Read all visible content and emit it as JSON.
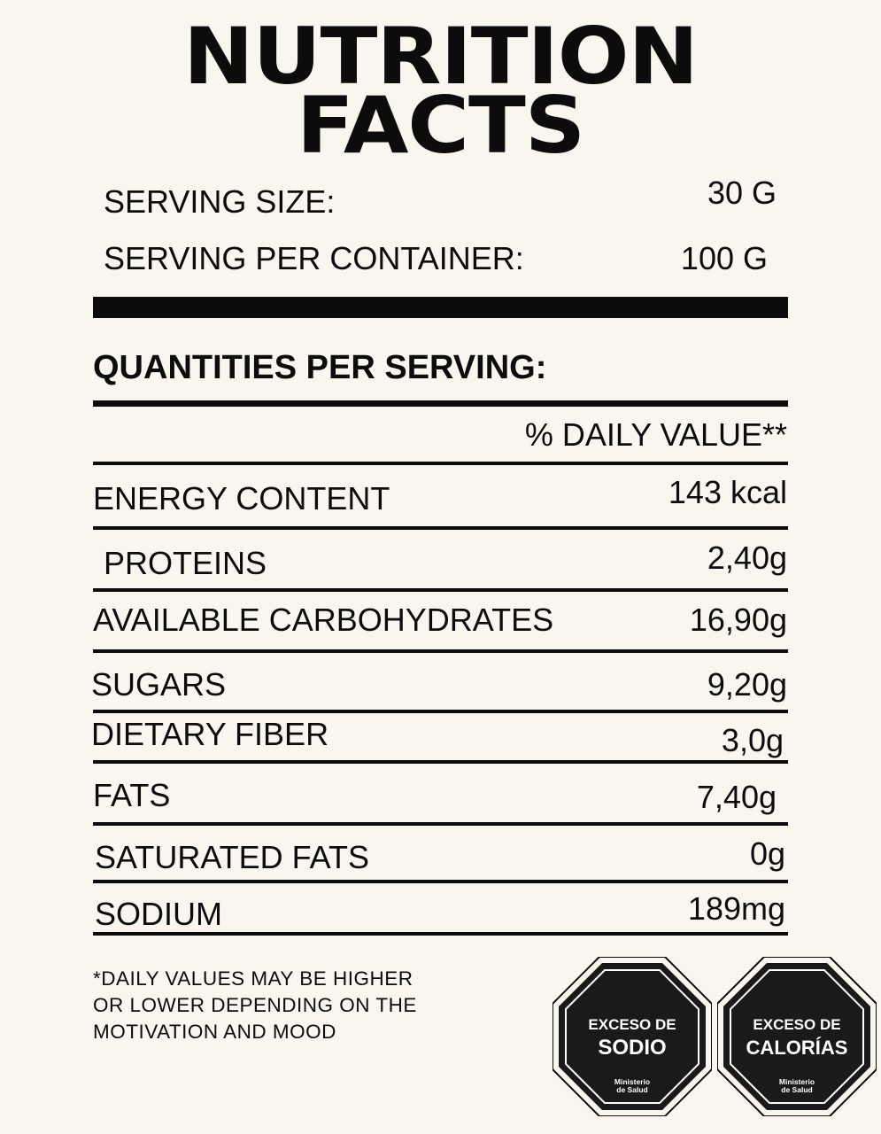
{
  "title": {
    "line1": "NUTRITION",
    "line2": "FACTS"
  },
  "serving": {
    "size_label": "SERVING SIZE:",
    "size_value": "30 G",
    "per_container_label": "SERVING PER CONTAINER:",
    "per_container_value": "100 G"
  },
  "section_heading": "QUANTITIES PER SERVING:",
  "daily_value_header": "% DAILY VALUE**",
  "nutrients": [
    {
      "label": "ENERGY CONTENT",
      "value": "143  kcal"
    },
    {
      "label": "PROTEINS",
      "value": "2,40g"
    },
    {
      "label": "AVAILABLE CARBOHYDRATES",
      "value": "16,90g"
    },
    {
      "label": "SUGARS",
      "value": "9,20g"
    },
    {
      "label": "DIETARY FIBER",
      "value": "3,0g"
    },
    {
      "label": "FATS",
      "value": "7,40g"
    },
    {
      "label": "SATURATED FATS",
      "value": "0g"
    },
    {
      "label": "SODIUM",
      "value": "189mg"
    }
  ],
  "footnote": [
    "*DAILY VALUES MAY BE HIGHER",
    "OR LOWER DEPENDING ON THE",
    "MOTIVATION AND MOOD"
  ],
  "seals": [
    {
      "line1": "EXCESO DE",
      "line2": "SODIO",
      "authority1": "Ministerio",
      "authority2": "de Salud"
    },
    {
      "line1": "EXCESO DE",
      "line2": "CALORÍAS",
      "authority1": "Ministerio",
      "authority2": "de Salud"
    }
  ],
  "colors": {
    "background": "#f9f6f0",
    "ink": "#0c0c0c",
    "seal_fill": "#1a1a1a",
    "seal_text": "#ffffff"
  }
}
